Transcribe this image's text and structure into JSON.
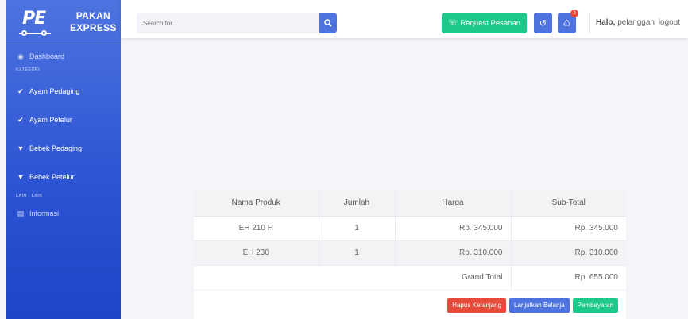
{
  "brand": {
    "logo_text": "PE",
    "line1": "PAKAN",
    "line2": "EXPRESS"
  },
  "sidebar": {
    "dashboard": "Dashboard",
    "heading_kategori": "KATEGORI",
    "items": [
      {
        "label": "Ayam Pedaging",
        "icon": "chicken-icon"
      },
      {
        "label": "Ayam Petelur",
        "icon": "chicken-icon"
      },
      {
        "label": "Bebek Pedaging",
        "icon": "duck-icon"
      },
      {
        "label": "Bebek Petelur",
        "icon": "duck-icon"
      }
    ],
    "heading_lain": "LAIN - LAIN",
    "informasi": "Informasi"
  },
  "topbar": {
    "search_placeholder": "Search for...",
    "request_label": "Request Pesanan",
    "cart_count": "2",
    "greeting": "Halo,",
    "username": "pelanggan",
    "logout": "logout"
  },
  "cart": {
    "headers": {
      "product": "Nama Produk",
      "qty": "Jumlah",
      "price": "Harga",
      "subtotal": "Sub-Total"
    },
    "rows": [
      {
        "product": "EH 210 H",
        "qty": "1",
        "price": "Rp. 345.000",
        "subtotal": "Rp. 345.000"
      },
      {
        "product": "EH 230",
        "qty": "1",
        "price": "Rp. 310.000",
        "subtotal": "Rp. 310.000"
      }
    ],
    "grand_total_label": "Grand Total",
    "grand_total_value": "Rp. 655.000",
    "buttons": {
      "clear": "Hapus Keranjang",
      "continue": "Lanjutkan Belanja",
      "pay": "Pembayaran"
    }
  },
  "colors": {
    "primary": "#4e73df",
    "success": "#1cc88a",
    "danger": "#e74a3b"
  }
}
